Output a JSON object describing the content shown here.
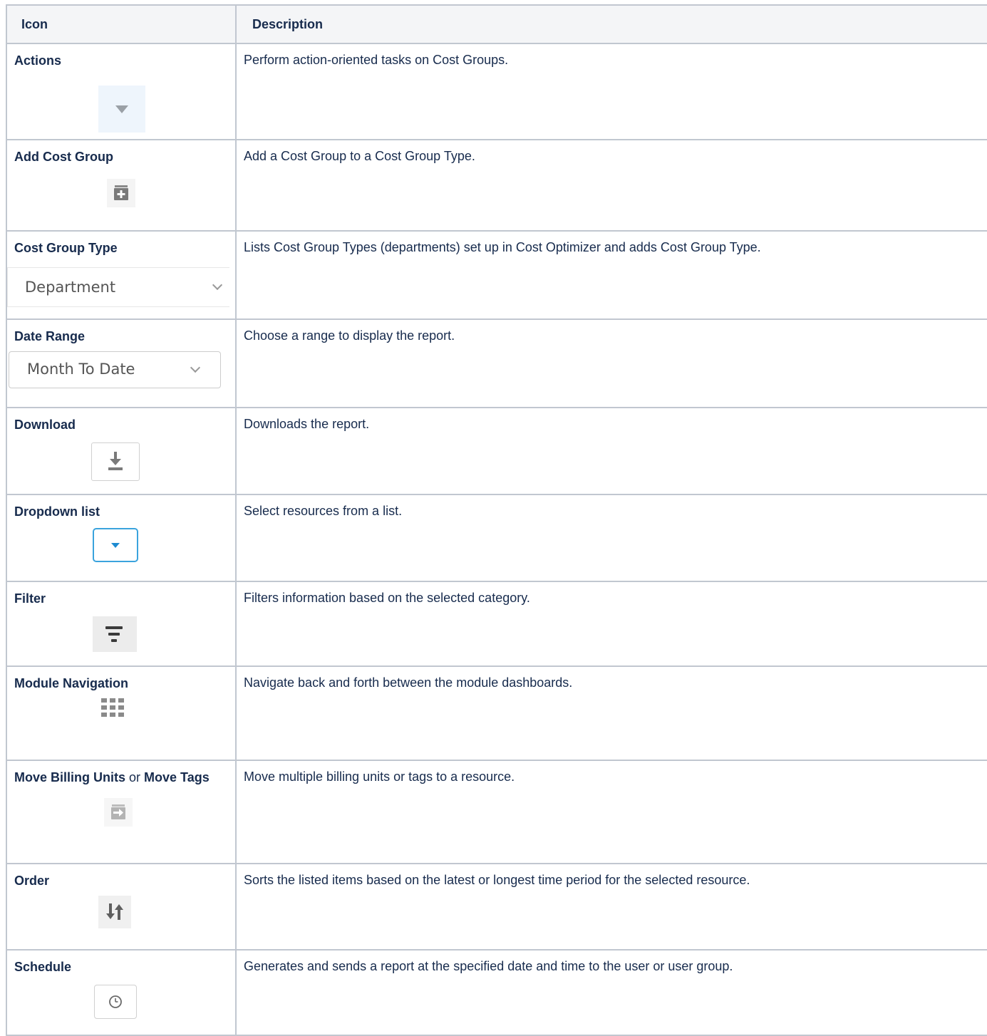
{
  "table": {
    "headers": {
      "icon": "Icon",
      "description": "Description"
    },
    "rows": [
      {
        "label": "Actions",
        "description": "Perform action-oriented tasks on Cost Groups.",
        "icon": "caret-down-icon"
      },
      {
        "label": "Add Cost Group",
        "description": "Add a Cost Group to a Cost Group Type.",
        "icon": "folder-plus-icon"
      },
      {
        "label": "Cost Group Type",
        "description": "Lists Cost Group Types (departments) set up in Cost Optimizer and adds Cost Group Type.",
        "icon": "select-dropdown",
        "control_value": "Department"
      },
      {
        "label": "Date Range",
        "description": "Choose a range to display the report.",
        "icon": "select-dropdown",
        "control_value": "Month To Date"
      },
      {
        "label": "Download",
        "description": "Downloads the report.",
        "icon": "download-icon"
      },
      {
        "label": "Dropdown list",
        "description": "Select resources from a list.",
        "icon": "caret-down-icon"
      },
      {
        "label": "Filter",
        "description": "Filters information based on the selected category.",
        "icon": "filter-icon"
      },
      {
        "label": "Module Navigation",
        "description": "Navigate back and forth between the module dashboards.",
        "icon": "grid-icon"
      },
      {
        "label_part1": "Move Billing Units",
        "label_or": " or ",
        "label_part2": "Move Tags",
        "description": "Move multiple billing units or tags to a resource.",
        "icon": "folder-move-icon"
      },
      {
        "label": "Order",
        "description": "Sorts the listed items based on the latest or longest time period for the selected resource.",
        "icon": "sort-icon"
      },
      {
        "label": "Schedule",
        "description": "Generates and sends a report at the specified date and time to the user or user group.",
        "icon": "clock-icon"
      }
    ]
  },
  "colors": {
    "border": "#c1c7d0",
    "header_bg": "#f4f5f7",
    "dropdown_accent": "#3aa3dd"
  }
}
